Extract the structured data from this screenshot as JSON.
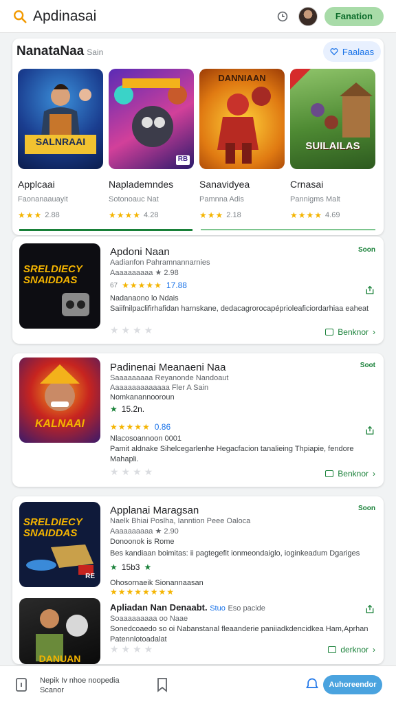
{
  "topbar": {
    "title": "Apdinasai",
    "action_label": "Fanation"
  },
  "featured": {
    "heading": "NanataNaa",
    "subheading": "Sain",
    "rates_label": "Faalaas",
    "tiles": [
      {
        "art_text": "SALNRAAI",
        "name": "Applcaai",
        "sub": "Faonanaauayit",
        "rating": "2.88",
        "stars": "★★★"
      },
      {
        "art_text": "RB",
        "name": "Naplademndes",
        "sub": "Sotonoauc Nat",
        "rating": "4.28",
        "stars": "★★★★"
      },
      {
        "art_text": "DANNIAAN",
        "name": "Sanavidyea",
        "sub": "Pamnna Adis",
        "rating": "2.18",
        "stars": "★★★"
      },
      {
        "art_text": "SUILAILAS",
        "name": "Crnasai",
        "sub": "Pannigms Malt",
        "rating": "4.69",
        "stars": "★★★★"
      }
    ]
  },
  "apps": [
    {
      "title": "Apdoni Naan",
      "line1": "Aadianfon Pahramnannarnies",
      "line2": "Aaaaaaaaaa ★ 2.98",
      "rating_prefix": "67",
      "rating_value": "17.88",
      "line3": "Nadanaono lo Ndais",
      "description": "Saiifnilpaclifirhafidan harnskane, dedacagrorocapéprioleaficiordarhiaa eaheat",
      "tag": "Soon",
      "action": "Benknor",
      "icon_text": "SRELDIECY SNAIDDAS"
    },
    {
      "title": "Padinenai Meanaeni Naa",
      "line1": "Saaaaaaaaa Reyanonde Nandoaut",
      "line2": "Aaaaaaaaaaaaaa Fler A Sain",
      "line3": "Nomkanannooroun",
      "rating_green": "15.2n.",
      "rating_value": "0.86",
      "line4": "Nlacosoannoon 0001",
      "description": "Pamit aldnake Sihelcegarlenhe Hegacfacion tanalieing Thpiapie, fendore Mahapli.",
      "tag": "Soot",
      "action": "Benknor",
      "icon_text": "KALNAAI"
    },
    {
      "title": "Applanai Maragsan",
      "line1": "Naelk Bhiai Poslha, Ianntion Peee Oaloca",
      "line2": "Aaaaaaaaaa ★ 2.90",
      "line3": "Donoonok is Rome",
      "description": "Bes kandiaan boimitas: ii pagtegefit ionmeondaiglo, ioginkeadum Dgariges",
      "rating_green": "15b3",
      "line4": "Ohosornaeik Sionannaasan",
      "title2": "Apliadan Nan Denaabt.",
      "title2_blue": "Stuo",
      "title2_tail": "Eso pacide",
      "line5": "Soaaaaaaaaa oo Naae",
      "description2": "Sonedcoaedo so oi Nabanstanal fleaanderie paniiadkdencidkea Ham,Aprhan Patennlotoadalat",
      "tag": "Soon",
      "action": "derknor",
      "icon_text": "SRELDIECY SNAIDDAS",
      "icon_text2": "RE",
      "icon_text3": "DANUAN"
    }
  ],
  "bottombar": {
    "text": "Nepik Iv nhoe noopedia Scanor",
    "pill": "Auhoreendor"
  },
  "colors": {
    "accent_green": "#188038",
    "pill_green_bg": "#a8dba8",
    "blue": "#1a73e8",
    "star": "#f4b400"
  }
}
